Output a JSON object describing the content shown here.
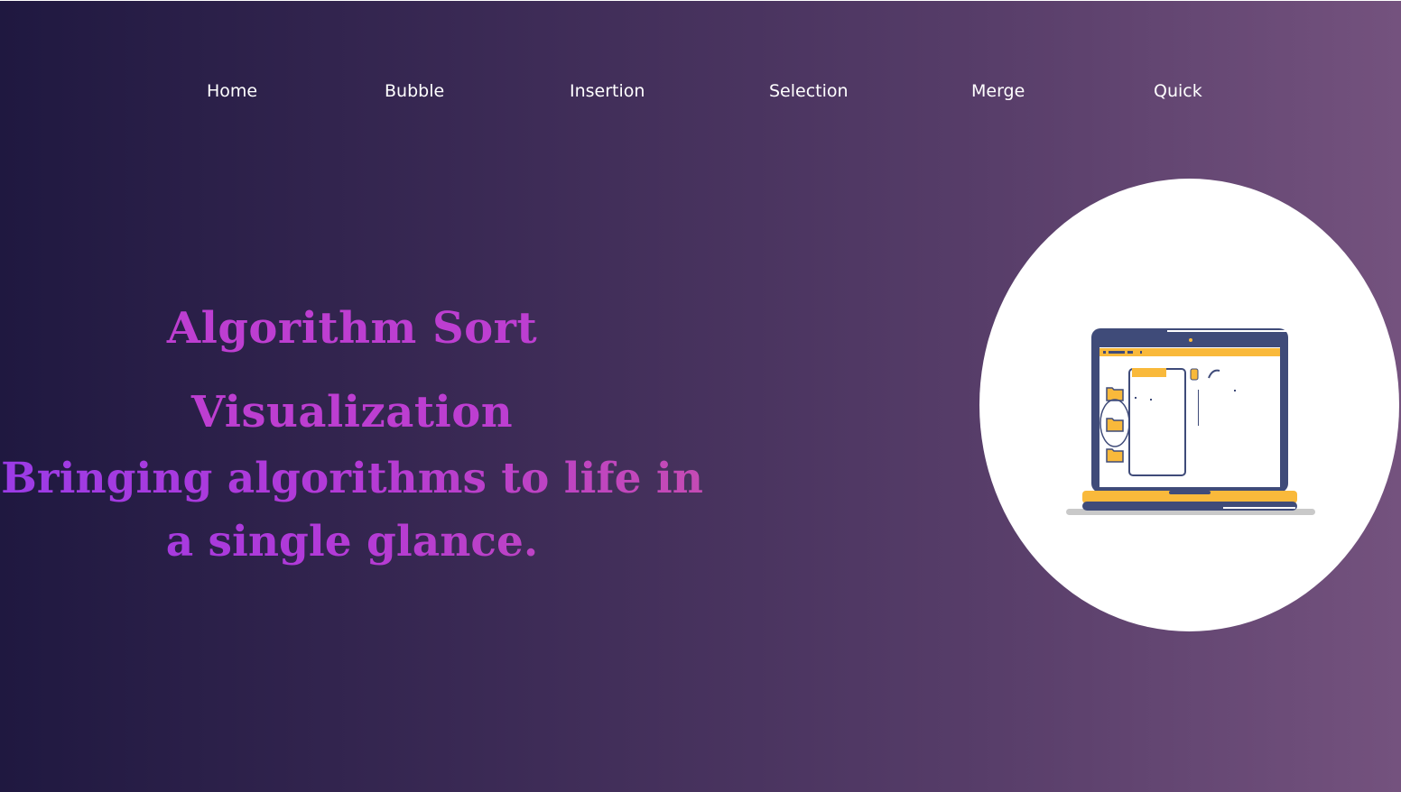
{
  "nav": {
    "items": [
      {
        "label": "Home"
      },
      {
        "label": "Bubble"
      },
      {
        "label": "Insertion"
      },
      {
        "label": "Selection"
      },
      {
        "label": "Merge"
      },
      {
        "label": "Quick"
      }
    ]
  },
  "hero": {
    "title_line1": "Algorithm Sort",
    "title_line2": "Visualization",
    "tagline": "Bringing algorithms to life in a single glance."
  },
  "illustration": {
    "icon": "laptop-folders-illustration"
  },
  "colors": {
    "background_start": "#1f1840",
    "background_end": "#74527e",
    "title": "#bd3ed1",
    "tagline": "#b233dc",
    "nav_text": "#ffffff",
    "laptop_frame": "#3f4b79",
    "laptop_accent": "#f9b93b"
  }
}
